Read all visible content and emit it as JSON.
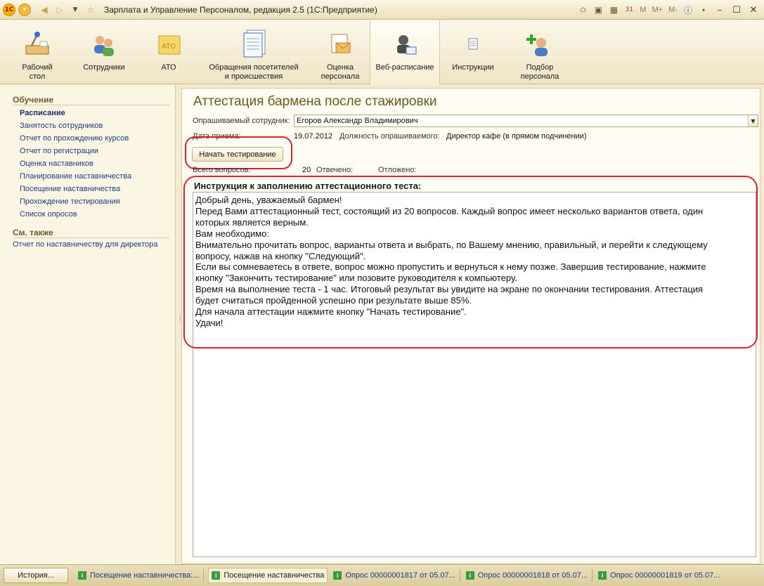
{
  "window": {
    "title": "Зарплата и Управление Персоналом, редакция 2.5  (1С:Предприятие)",
    "right_labels": [
      "M",
      "M+",
      "M-"
    ]
  },
  "toolbar": {
    "items": [
      {
        "label": "Рабочий\nстол",
        "icon": "desk-lamp-icon"
      },
      {
        "label": "Сотрудники",
        "icon": "people-icon"
      },
      {
        "label": "АТО",
        "icon": "ato-icon"
      },
      {
        "label": "Обращения посетителей\nи происшествия",
        "icon": "documents-icon"
      },
      {
        "label": "Оценка\nперсонала",
        "icon": "envelope-icon"
      },
      {
        "label": "Веб-расписание",
        "icon": "web-schedule-icon"
      },
      {
        "label": "Инструкции",
        "icon": "instruction-icon"
      },
      {
        "label": "Подбор\nперсонала",
        "icon": "add-person-icon"
      }
    ]
  },
  "nav": {
    "section_title": "Обучение",
    "items": [
      "Расписание",
      "Занятость сотрудников",
      "Отчет по прохождению курсов",
      "Отчет по регистрации",
      "Оценка наставников",
      "Планирование наставничества",
      "Посещение наставничества",
      "Прохождение тестирования",
      "Список опросов"
    ],
    "see_also_title": "См. также",
    "see_also_items": [
      "Отчет по наставничеству для директора"
    ]
  },
  "form": {
    "title": "Аттестация бармена после стажировки",
    "employee_label": "Опрашиваемый сотрудник:",
    "employee_value": "Егоров Александр Владимирович",
    "hire_date_label": "Дата приема:",
    "hire_date_value": "19.07.2012",
    "position_label": "Должность опрашиваемого:",
    "position_value": "Директор кафе (в прямом подчинении)",
    "start_button": "Начать тестирование",
    "total_label": "Всего вопросов:",
    "total_value": "20",
    "answered_label": "Отвечено:",
    "postponed_label": "Отложено:",
    "instruction_title": "Инструкция к заполнению аттестационного теста:",
    "instruction_lines": [
      "Добрый день, уважаемый бармен!",
      "Перед Вами аттестационный тест, состоящий из 20 вопросов. Каждый вопрос имеет несколько вариантов ответа, один",
      "которых является верным.",
      "Вам необходимо:",
      "Внимательно прочитать вопрос, варианты ответа и выбрать, по Вашему мнению, правильный, и перейти к следующему",
      "вопросу, нажав на кнопку \"Следующий\".",
      "Если вы сомневаетесь в ответе, вопрос можно пропустить и вернуться к нему позже. Завершив тестирование, нажмите",
      "кнопку \"Закончить тестирование\" или позовите руководителя к компьютеру.",
      "Время на выполнение теста - 1 час. Итоговый результат вы увидите на экране по окончании  тестирования. Аттестация",
      "будет считаться пройденной успешно при результате выше 85%.",
      "Для начала аттестации нажмите кнопку \"Начать тестирование\".",
      "Удачи!"
    ]
  },
  "statusbar": {
    "history_button": "История...",
    "tasks": [
      "Посещение наставничества:...",
      "Посещение наставничества",
      "Опрос 00000001817 от 05.07...",
      "Опрос 00000001818 от 05.07...",
      "Опрос 00000001819 от 05.07..."
    ]
  },
  "colors": {
    "accent": "#6a5a1a",
    "link": "#1a3a8a",
    "highlight_marker": "#e0202a"
  }
}
